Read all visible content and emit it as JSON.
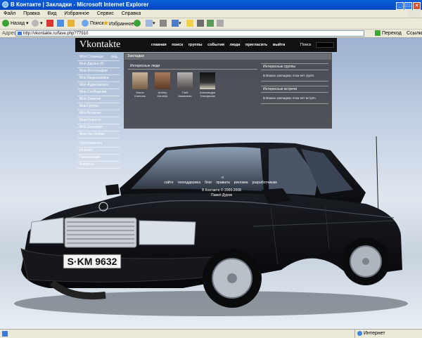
{
  "window": {
    "title": "В Контакте | Закладки - Microsoft Internet Explorer"
  },
  "menubar": [
    "Файл",
    "Правка",
    "Вид",
    "Избранное",
    "Сервис",
    "Справка"
  ],
  "toolbar": {
    "back_label": "Назад",
    "search_label": "Поиск",
    "favorites_label": "Избранное"
  },
  "addressbar": {
    "label": "Адрес:",
    "url": "http://vkontakte.ru/fave.php?77910",
    "go_label": "Переход",
    "links_label": "Ссылки"
  },
  "page": {
    "logo": "Vkontakte",
    "nav": [
      "главная",
      "поиск",
      "группы",
      "события",
      "люди",
      "пригласить",
      "выйти"
    ],
    "search_label": "Поиск",
    "menu_edit": "ред.",
    "menu": [
      "Моя Страница",
      "Мои Друзья (6)",
      "Мои Фотографии",
      "Мои Видеозаписи",
      "Мои Аудиозаписи",
      "Мои Сообщения",
      "Мои Заметки",
      "Мои Группы",
      "Мои Встречи",
      "Мои Новости",
      "Мои Закладки",
      "Мои Настройки"
    ],
    "menu2": [
      "Предложения",
      "Мнения",
      "Приложения",
      "Вопросы"
    ],
    "main_title": "Закладки",
    "friends_title": "Интересные люди",
    "friends": [
      {
        "first": "Настя",
        "last": "Клепова"
      },
      {
        "first": "Andrey",
        "last": "Karantyr"
      },
      {
        "first": "Глеб",
        "last": "Амишанко"
      },
      {
        "first": "Александра",
        "last": "Тимофеева"
      }
    ],
    "groups_title": "Интересные группы",
    "groups_text": "В Ваших закладках пока нет групп.",
    "events_title": "Интересные встречи",
    "events_text": "В Ваших закладках пока нет встреч.",
    "footer_links": [
      "о сайте",
      "техподдержка",
      "блог",
      "правила",
      "реклама",
      "разработчикам"
    ],
    "copyright": "В Контакте © 2006-2008",
    "author": "Павел Дуров"
  },
  "plate": "S·KM 9632",
  "status": {
    "zone": "Интернет"
  }
}
